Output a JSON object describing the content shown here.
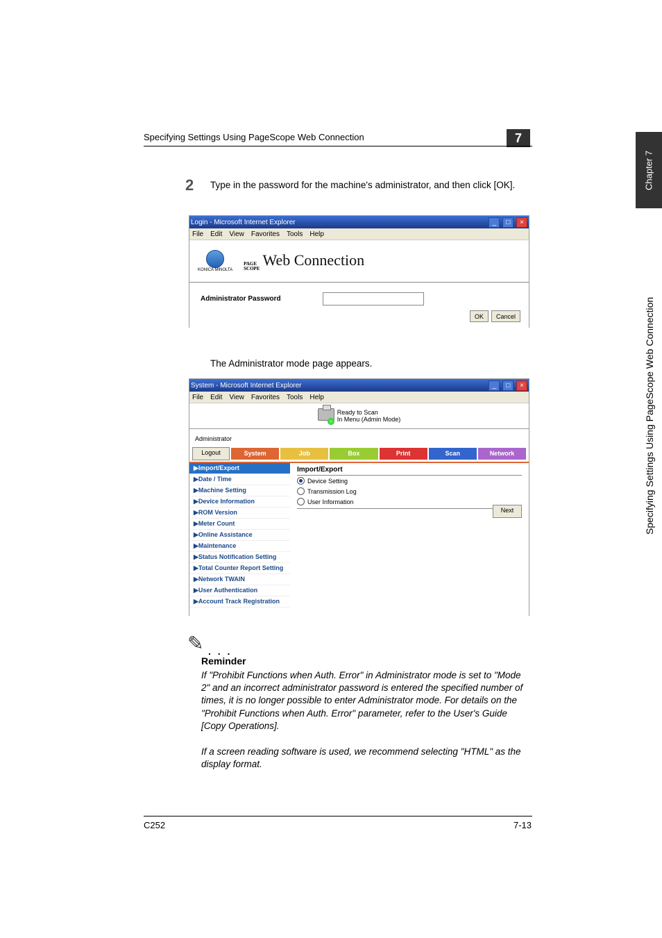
{
  "header": {
    "title": "Specifying Settings Using PageScope Web Connection",
    "chapter_num": "7"
  },
  "sidebar": {
    "chapter": "Chapter 7",
    "title": "Specifying Settings Using PageScope Web Connection"
  },
  "step": {
    "num": "2",
    "text": "Type in the password for the machine's administrator, and then click [OK]."
  },
  "win1": {
    "title": "Login - Microsoft Internet Explorer",
    "menu": [
      "File",
      "Edit",
      "View",
      "Favorites",
      "Tools",
      "Help"
    ],
    "km_label": "KONICA MINOLTA",
    "ps_top": "PAGE",
    "ps_bottom": "SCOPE",
    "ps_main": "Web Connection",
    "pw_label": "Administrator Password",
    "ok": "OK",
    "cancel": "Cancel"
  },
  "caption": "The Administrator mode page appears.",
  "win2": {
    "title": "System - Microsoft Internet Explorer",
    "menu": [
      "File",
      "Edit",
      "View",
      "Favorites",
      "Tools",
      "Help"
    ],
    "status_ready": "Ready to Scan",
    "status_mode": "In Menu (Admin Mode)",
    "admin_label": "Administrator",
    "logout": "Logout",
    "tabs": [
      "System",
      "Job",
      "Box",
      "Print",
      "Scan",
      "Network"
    ],
    "nav": [
      "▶Import/Export",
      "▶Date / Time",
      "▶Machine Setting",
      "▶Device Information",
      "▶ROM Version",
      "▶Meter Count",
      "▶Online Assistance",
      "▶Maintenance",
      "▶Status Notification Setting",
      "▶Total Counter Report Setting",
      "▶Network TWAIN",
      "▶User Authentication",
      "▶Account Track Registration"
    ],
    "panel_title": "Import/Export",
    "radios": [
      "Device Setting",
      "Transmission Log",
      "User Information"
    ],
    "next": "Next"
  },
  "reminder": {
    "title": "Reminder",
    "body1": "If \"Prohibit Functions when Auth. Error\" in Administrator mode is set to \"Mode 2\" and an incorrect administrator password is entered the specified number of times, it is no longer possible to enter Administrator mode. For details on the \"Prohibit Functions when Auth. Error\" parameter, refer to the User's Guide [Copy Operations].",
    "body2": "If a screen reading software is used, we recommend selecting \"HTML\" as the display format."
  },
  "footer": {
    "left": "C252",
    "right": "7-13"
  }
}
